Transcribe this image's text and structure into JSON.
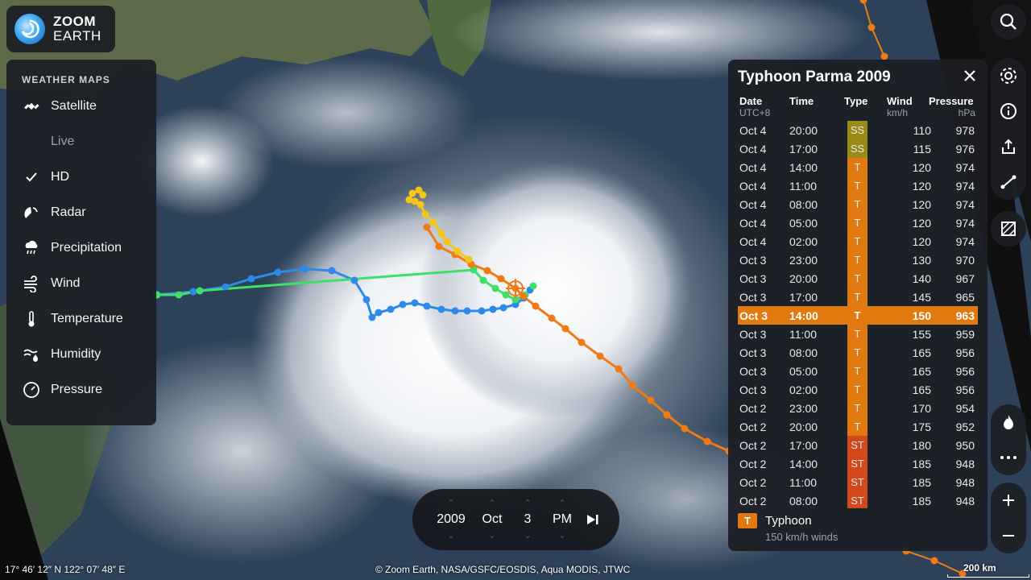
{
  "app": {
    "logo_line1": "ZOOM",
    "logo_line2": "EARTH"
  },
  "weather_maps": {
    "title": "WEATHER MAPS",
    "items": [
      {
        "label": "Satellite",
        "icon": "satellite-icon"
      },
      {
        "label": "Live",
        "icon": "",
        "sub": true
      },
      {
        "label": "HD",
        "icon": "checkmark-icon",
        "sub": true,
        "checked": true
      },
      {
        "label": "Radar",
        "icon": "radar-icon"
      },
      {
        "label": "Precipitation",
        "icon": "precipitation-icon"
      },
      {
        "label": "Wind",
        "icon": "wind-icon"
      },
      {
        "label": "Temperature",
        "icon": "thermometer-icon"
      },
      {
        "label": "Humidity",
        "icon": "humidity-icon"
      },
      {
        "label": "Pressure",
        "icon": "pressure-icon"
      }
    ]
  },
  "storm": {
    "title": "Typhoon Parma 2009",
    "headers": {
      "date": "Date",
      "date_sub": "UTC+8",
      "time": "Time",
      "type": "Type",
      "wind": "Wind",
      "wind_sub": "km/h",
      "pressure": "Pressure",
      "pressure_sub": "hPa"
    },
    "rows": [
      {
        "date": "Oct 4",
        "time": "20:00",
        "type": "SS",
        "wind": "110",
        "pressure": "978"
      },
      {
        "date": "Oct 4",
        "time": "17:00",
        "type": "SS",
        "wind": "115",
        "pressure": "976"
      },
      {
        "date": "Oct 4",
        "time": "14:00",
        "type": "T",
        "wind": "120",
        "pressure": "974"
      },
      {
        "date": "Oct 4",
        "time": "11:00",
        "type": "T",
        "wind": "120",
        "pressure": "974"
      },
      {
        "date": "Oct 4",
        "time": "08:00",
        "type": "T",
        "wind": "120",
        "pressure": "974"
      },
      {
        "date": "Oct 4",
        "time": "05:00",
        "type": "T",
        "wind": "120",
        "pressure": "974"
      },
      {
        "date": "Oct 4",
        "time": "02:00",
        "type": "T",
        "wind": "120",
        "pressure": "974"
      },
      {
        "date": "Oct 3",
        "time": "23:00",
        "type": "T",
        "wind": "130",
        "pressure": "970"
      },
      {
        "date": "Oct 3",
        "time": "20:00",
        "type": "T",
        "wind": "140",
        "pressure": "967"
      },
      {
        "date": "Oct 3",
        "time": "17:00",
        "type": "T",
        "wind": "145",
        "pressure": "965"
      },
      {
        "date": "Oct 3",
        "time": "14:00",
        "type": "T",
        "wind": "150",
        "pressure": "963",
        "selected": true
      },
      {
        "date": "Oct 3",
        "time": "11:00",
        "type": "T",
        "wind": "155",
        "pressure": "959"
      },
      {
        "date": "Oct 3",
        "time": "08:00",
        "type": "T",
        "wind": "165",
        "pressure": "956"
      },
      {
        "date": "Oct 3",
        "time": "05:00",
        "type": "T",
        "wind": "165",
        "pressure": "956"
      },
      {
        "date": "Oct 3",
        "time": "02:00",
        "type": "T",
        "wind": "165",
        "pressure": "956"
      },
      {
        "date": "Oct 2",
        "time": "23:00",
        "type": "T",
        "wind": "170",
        "pressure": "954"
      },
      {
        "date": "Oct 2",
        "time": "20:00",
        "type": "T",
        "wind": "175",
        "pressure": "952"
      },
      {
        "date": "Oct 2",
        "time": "17:00",
        "type": "ST",
        "wind": "180",
        "pressure": "950"
      },
      {
        "date": "Oct 2",
        "time": "14:00",
        "type": "ST",
        "wind": "185",
        "pressure": "948"
      },
      {
        "date": "Oct 2",
        "time": "11:00",
        "type": "ST",
        "wind": "185",
        "pressure": "948"
      },
      {
        "date": "Oct 2",
        "time": "08:00",
        "type": "ST",
        "wind": "185",
        "pressure": "948"
      }
    ],
    "legend": {
      "badge": "T",
      "label": "Typhoon",
      "sub": "150 km/h winds"
    },
    "type_colors": {
      "SS": "#9a8a16",
      "T": "#e07a10",
      "ST": "#d2481a"
    }
  },
  "timebar": {
    "year": "2009",
    "month": "Oct",
    "day": "3",
    "ampm": "PM"
  },
  "status": {
    "coordinates": "17° 46′ 12″ N   122° 07′ 48″ E",
    "credit": "© Zoom Earth, NASA/GSFC/EOSDIS, Aqua MODIS, JTWC",
    "scale": "200 km"
  },
  "colors": {
    "accent": "#e07a10",
    "panel": "#1c1e24",
    "track_blue": "#2e8ae6",
    "track_green": "#3ee06a",
    "track_yellow": "#f5c518"
  }
}
